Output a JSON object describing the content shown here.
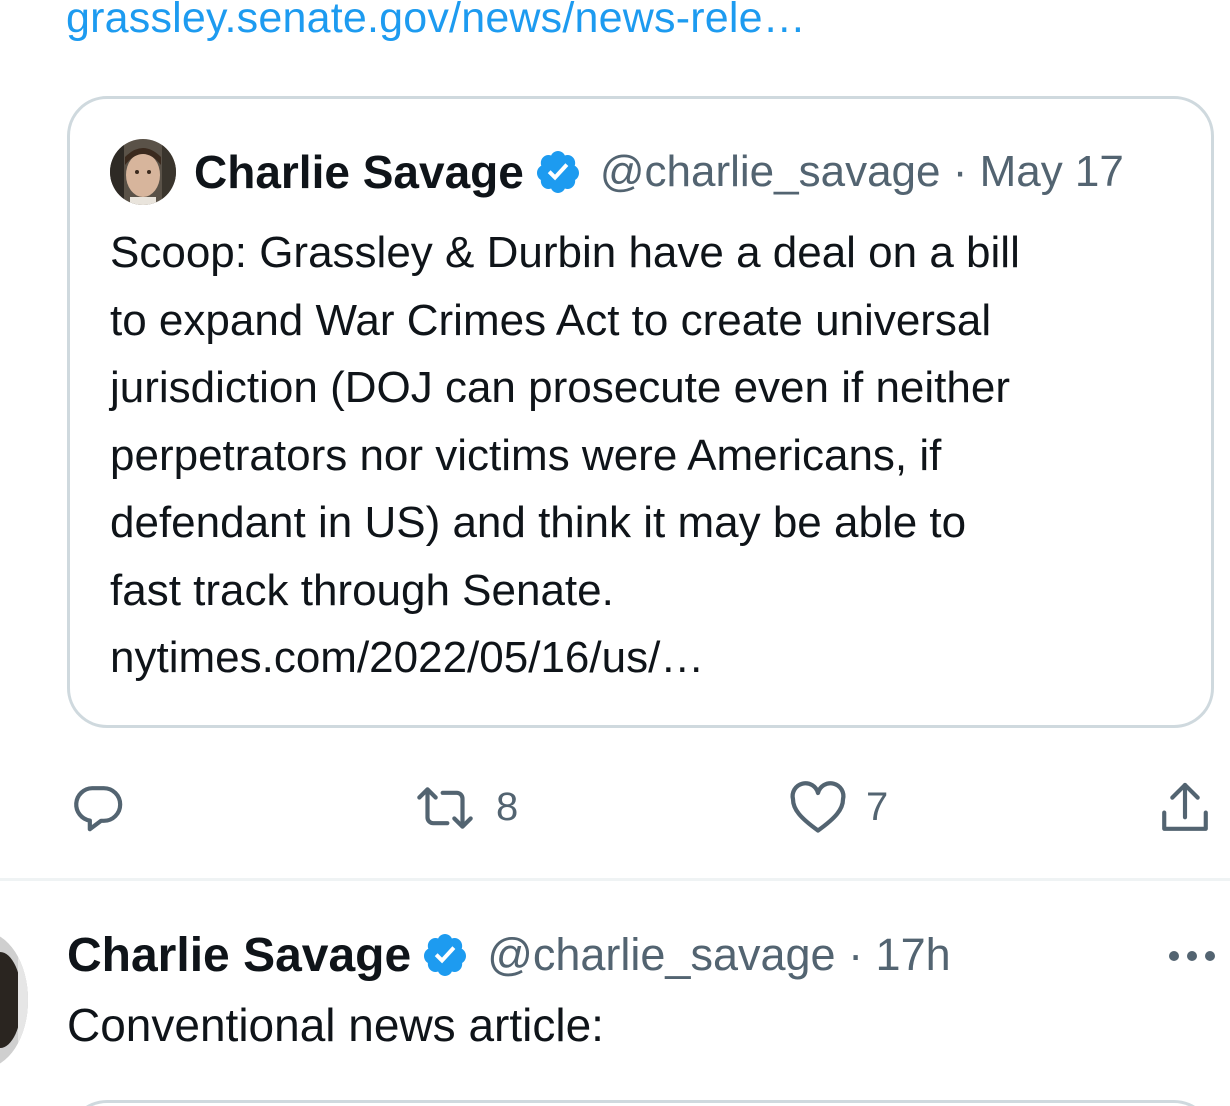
{
  "top_link": {
    "text": "grassley.senate.gov/news/news-rele…"
  },
  "quoted_tweet": {
    "author_name": "Charlie Savage",
    "handle_and_time": "@charlie_savage · May 17",
    "text": "Scoop: Grassley & Durbin have a deal on a bill\nto expand War Crimes Act to create universal\njurisdiction (DOJ can prosecute even if neither\nperpetrators nor victims were Americans, if\ndefendant in US) and think it may be able to\nfast track through Senate.",
    "link": "nytimes.com/2022/05/16/us/…",
    "avatar_icon": "user-avatar",
    "verified_icon": "verified-badge-icon"
  },
  "actions": {
    "reply_icon": "reply-icon",
    "retweet_icon": "retweet-icon",
    "retweet_count": "8",
    "like_icon": "heart-icon",
    "like_count": "7",
    "share_icon": "share-icon"
  },
  "next_tweet": {
    "author_name": "Charlie Savage",
    "handle_and_time": "@charlie_savage · 17h",
    "text": "Conventional news article:",
    "more_icon": "more-options-icon"
  },
  "colors": {
    "accent_blue": "#1d9bf0",
    "text_primary": "#0f1419",
    "text_secondary": "#536471",
    "border": "#cfd9de",
    "divider": "#eff3f4"
  }
}
